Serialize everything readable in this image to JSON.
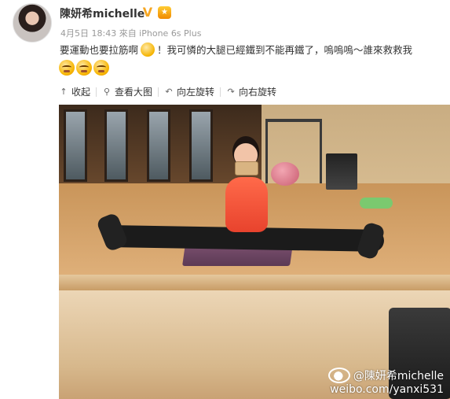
{
  "post": {
    "author": "陳妍希michelle",
    "verified_badge": "V",
    "member_badge": "★",
    "meta": "4月5日 18:43 來自 iPhone 6s Plus",
    "text_before_emoji": "要運動也要拉筋啊",
    "text_after_emoji": "！我可憐的大腿已經鐵到不能再鐵了，嗚嗚嗚～誰來救救我",
    "emoji_row": [
      "crying-face",
      "crying-face",
      "crying-face"
    ]
  },
  "toolbar": {
    "collapse_label": "收起",
    "view_large_label": "查看大图",
    "rotate_left_label": "向左旋转",
    "rotate_right_label": "向右旋转",
    "collapse_icon": "↑",
    "view_large_icon": "⚲",
    "rotate_left_icon": "↶",
    "rotate_right_icon": "↷"
  },
  "watermark": {
    "handle": "@陳妍希michelle",
    "url": "weibo.com/yanxi531"
  },
  "colors": {
    "verified": "#f5a623",
    "text": "#333333",
    "meta": "#999999"
  }
}
